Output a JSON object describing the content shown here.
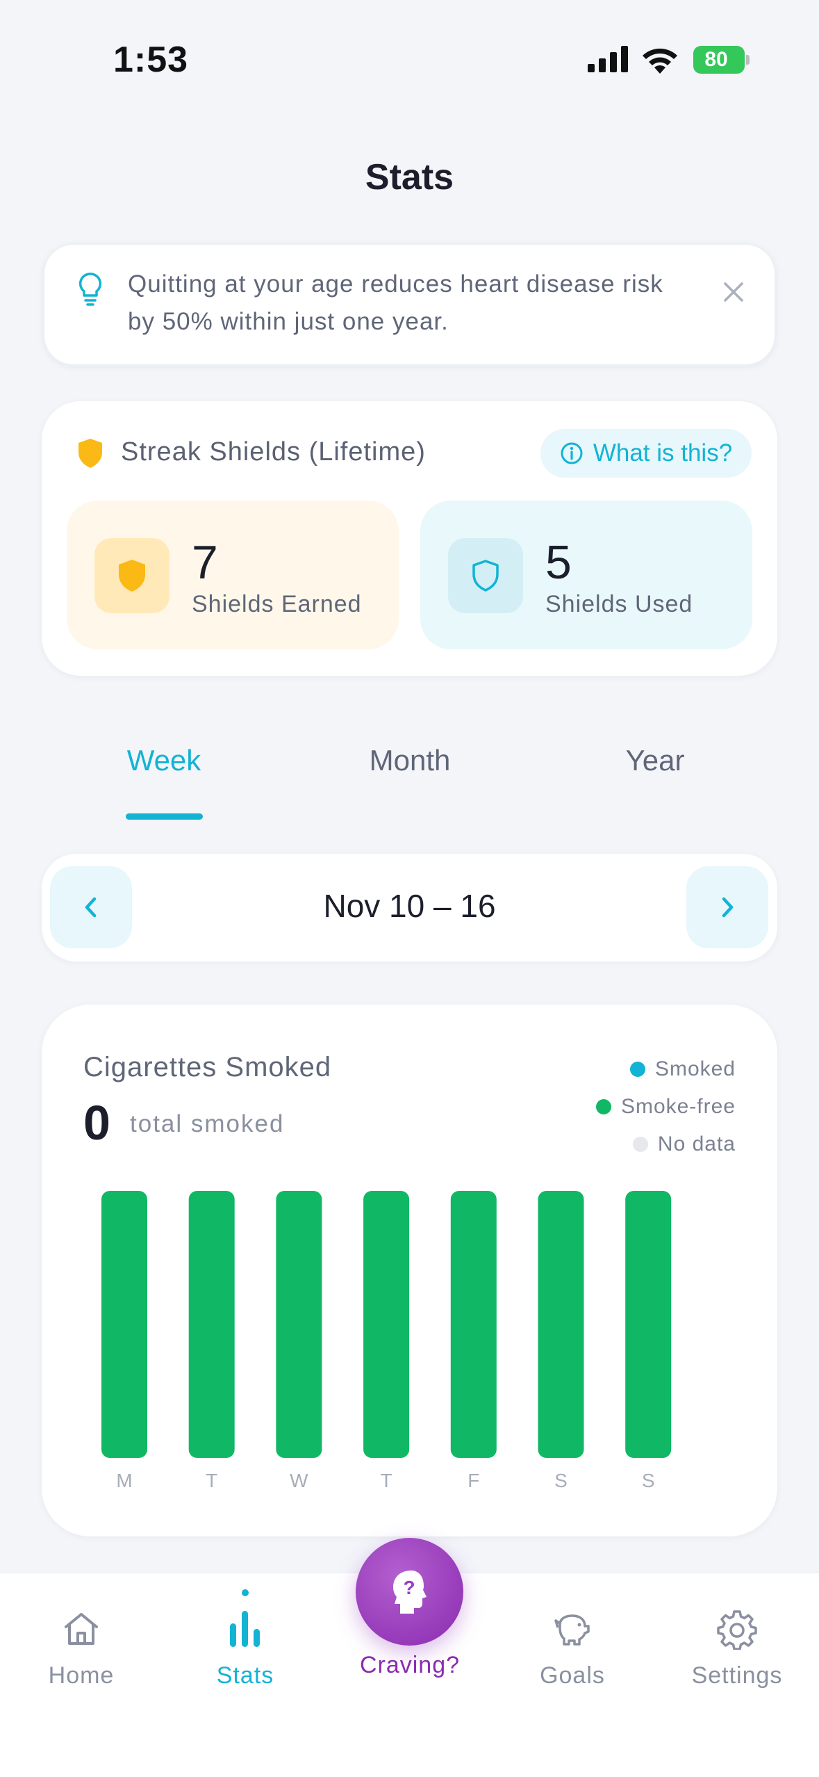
{
  "status_bar": {
    "time": "1:53",
    "battery": "80"
  },
  "page": {
    "title": "Stats"
  },
  "tip": {
    "text": "Quitting at your age reduces heart disease risk by 50% within just one year."
  },
  "shields": {
    "title": "Streak Shields (Lifetime)",
    "what_label": "What is this?",
    "earned": {
      "value": "7",
      "label": "Shields Earned"
    },
    "used": {
      "value": "5",
      "label": "Shields Used"
    }
  },
  "tabs": [
    {
      "label": "Week",
      "active": true
    },
    {
      "label": "Month",
      "active": false
    },
    {
      "label": "Year",
      "active": false
    }
  ],
  "date_range": "Nov 10 – 16",
  "chart_data": {
    "type": "bar",
    "title": "Cigarettes Smoked",
    "total": "0",
    "total_label": "total smoked",
    "categories": [
      "M",
      "T",
      "W",
      "T",
      "F",
      "S",
      "S"
    ],
    "series": [
      {
        "name": "Smoked",
        "values": [
          0,
          0,
          0,
          0,
          0,
          0,
          0
        ]
      },
      {
        "name": "Smoke-free",
        "values": [
          1,
          1,
          1,
          1,
          1,
          1,
          1
        ]
      },
      {
        "name": "No data",
        "values": [
          0,
          0,
          0,
          0,
          0,
          0,
          0
        ]
      }
    ],
    "legend": [
      {
        "label": "Smoked",
        "color": "#13b3d4"
      },
      {
        "label": "Smoke-free",
        "color": "#10b865"
      },
      {
        "label": "No data",
        "color": "#e6e8ec"
      }
    ],
    "legend_position": "top-right"
  },
  "bottom_nav": {
    "home": "Home",
    "stats": "Stats",
    "craving": "Craving?",
    "goals": "Goals",
    "settings": "Settings"
  },
  "colors": {
    "accent": "#13b3d4",
    "shield_gold": "#fbb915",
    "bar_green": "#10b865",
    "craving_purple": "#8a2bb0"
  }
}
